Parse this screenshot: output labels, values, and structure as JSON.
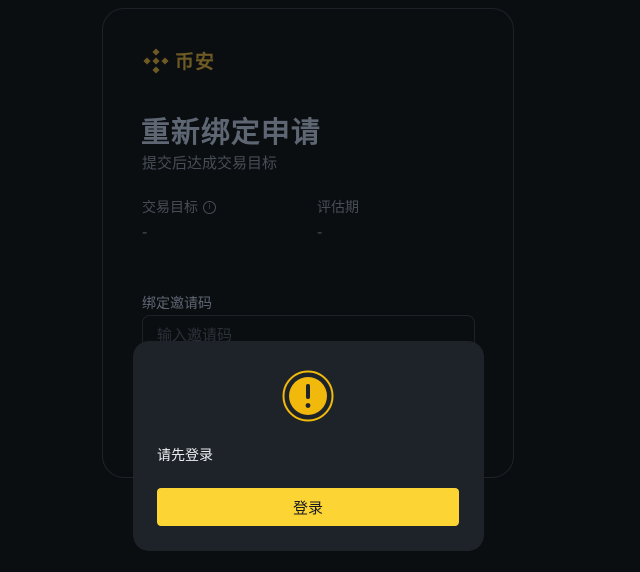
{
  "brand": {
    "name": "币安",
    "logo_icon": "binance-logo-icon",
    "color": "#6e5a24"
  },
  "page": {
    "title": "重新绑定申请",
    "subtitle": "提交后达成交易目标"
  },
  "stats": [
    {
      "label": "交易目标",
      "value": "-",
      "has_info": true,
      "info_icon": "info-icon"
    },
    {
      "label": "评估期",
      "value": "-",
      "has_info": false
    }
  ],
  "invite_field": {
    "label": "绑定邀请码",
    "placeholder": "输入邀请码",
    "value": ""
  },
  "modal": {
    "icon": "exclamation-warning-icon",
    "message": "请先登录",
    "button_label": "登录",
    "button_color": "#fcd535"
  },
  "colors": {
    "background": "#0b0e11",
    "modal_bg": "#1e2329",
    "accent": "#f0b90b"
  }
}
